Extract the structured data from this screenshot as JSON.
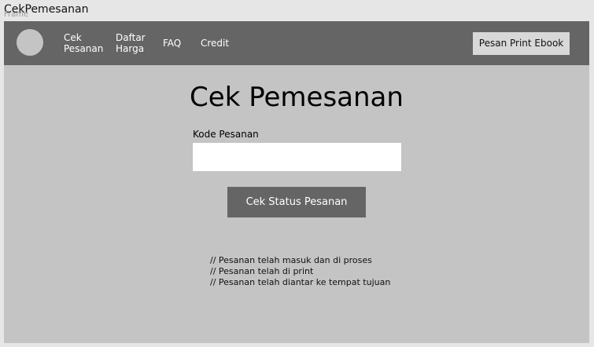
{
  "window": {
    "title": "CekPemesanan",
    "frame_label": "Frame"
  },
  "navbar": {
    "nav_cek_line1": "Cek",
    "nav_cek_line2": "Pesanan",
    "nav_harga_line1": "Daftar",
    "nav_harga_line2": "Harga",
    "nav_faq": "FAQ",
    "nav_credit": "Credit",
    "cta_label": "Pesan Print Ebook"
  },
  "main": {
    "title": "Cek Pemesanan",
    "field_label": "Kode Pesanan",
    "field_value": "",
    "button_label": "Cek Status Pesanan",
    "status_lines": [
      "// Pesanan telah masuk dan di proses",
      "// Pesanan telah di print",
      "// Pesanan telah diantar ke tempat tujuan"
    ]
  },
  "colors": {
    "navbar_bg": "#656565",
    "frame_bg": "#c4c4c4",
    "button_bg": "#656565",
    "cta_bg": "#d8d8d8"
  }
}
